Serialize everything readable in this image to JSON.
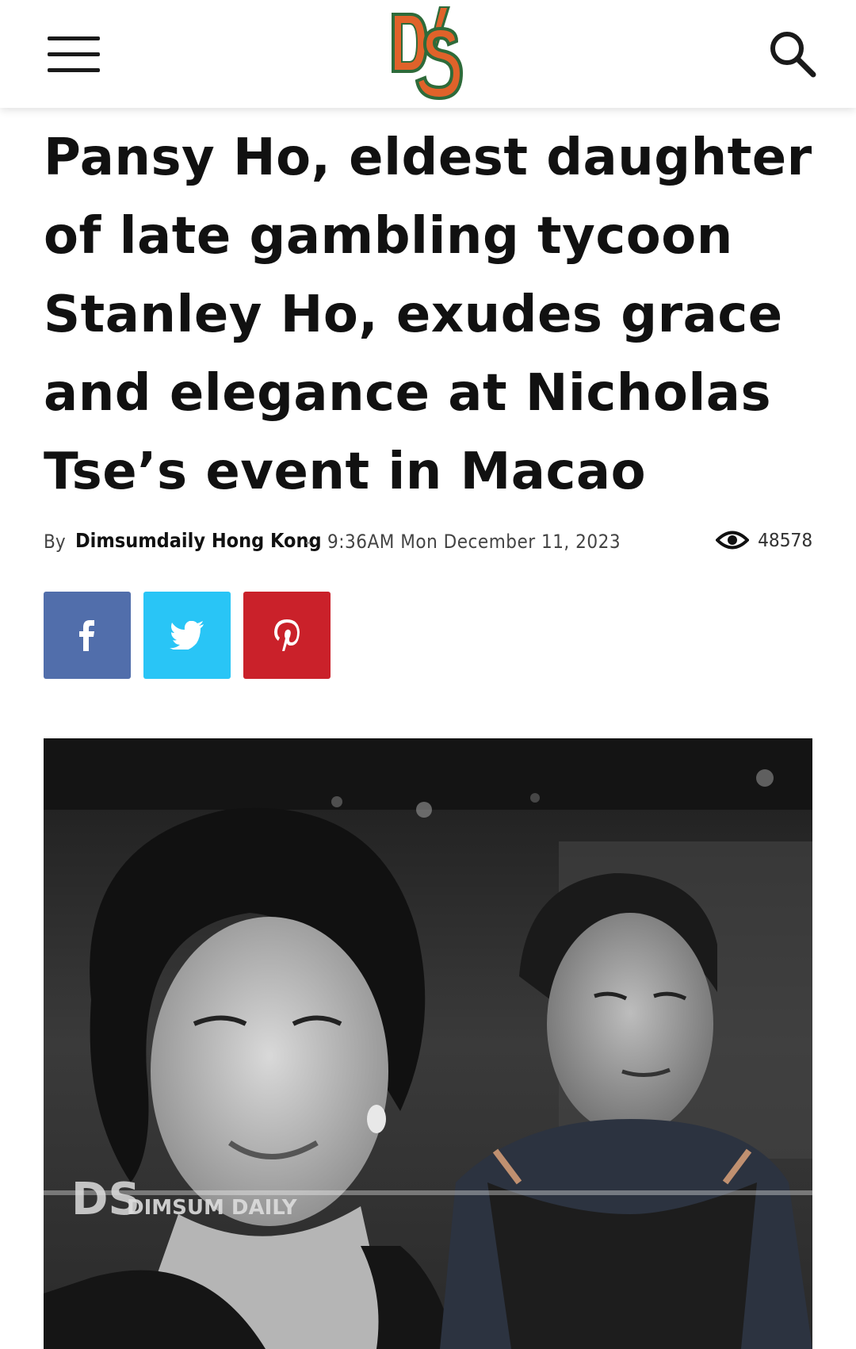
{
  "header": {
    "menu_icon": "hamburger-menu-icon",
    "logo_text": "DS",
    "search_icon": "search-icon"
  },
  "article": {
    "title": "Pansy Ho, eldest daughter of late gambling tycoon Stanley Ho, exudes grace and elegance at Nicholas Tse’s event in Macao",
    "by_label": "By",
    "author": "Dimsumdaily Hong Kong",
    "separator": "-",
    "date": "9:36AM Mon December 11, 2023",
    "views_icon": "eye-icon",
    "views": "48578"
  },
  "share": {
    "facebook_icon": "facebook-icon",
    "twitter_icon": "twitter-icon",
    "pinterest_icon": "pinterest-icon"
  },
  "image": {
    "watermark_logo": "DS",
    "watermark_text": "DIMSUM DAILY"
  },
  "colors": {
    "facebook": "#516eab",
    "twitter": "#29c5f6",
    "pinterest": "#ca212a",
    "logo_orange": "#e0622a",
    "logo_green": "#2e6b3a"
  }
}
